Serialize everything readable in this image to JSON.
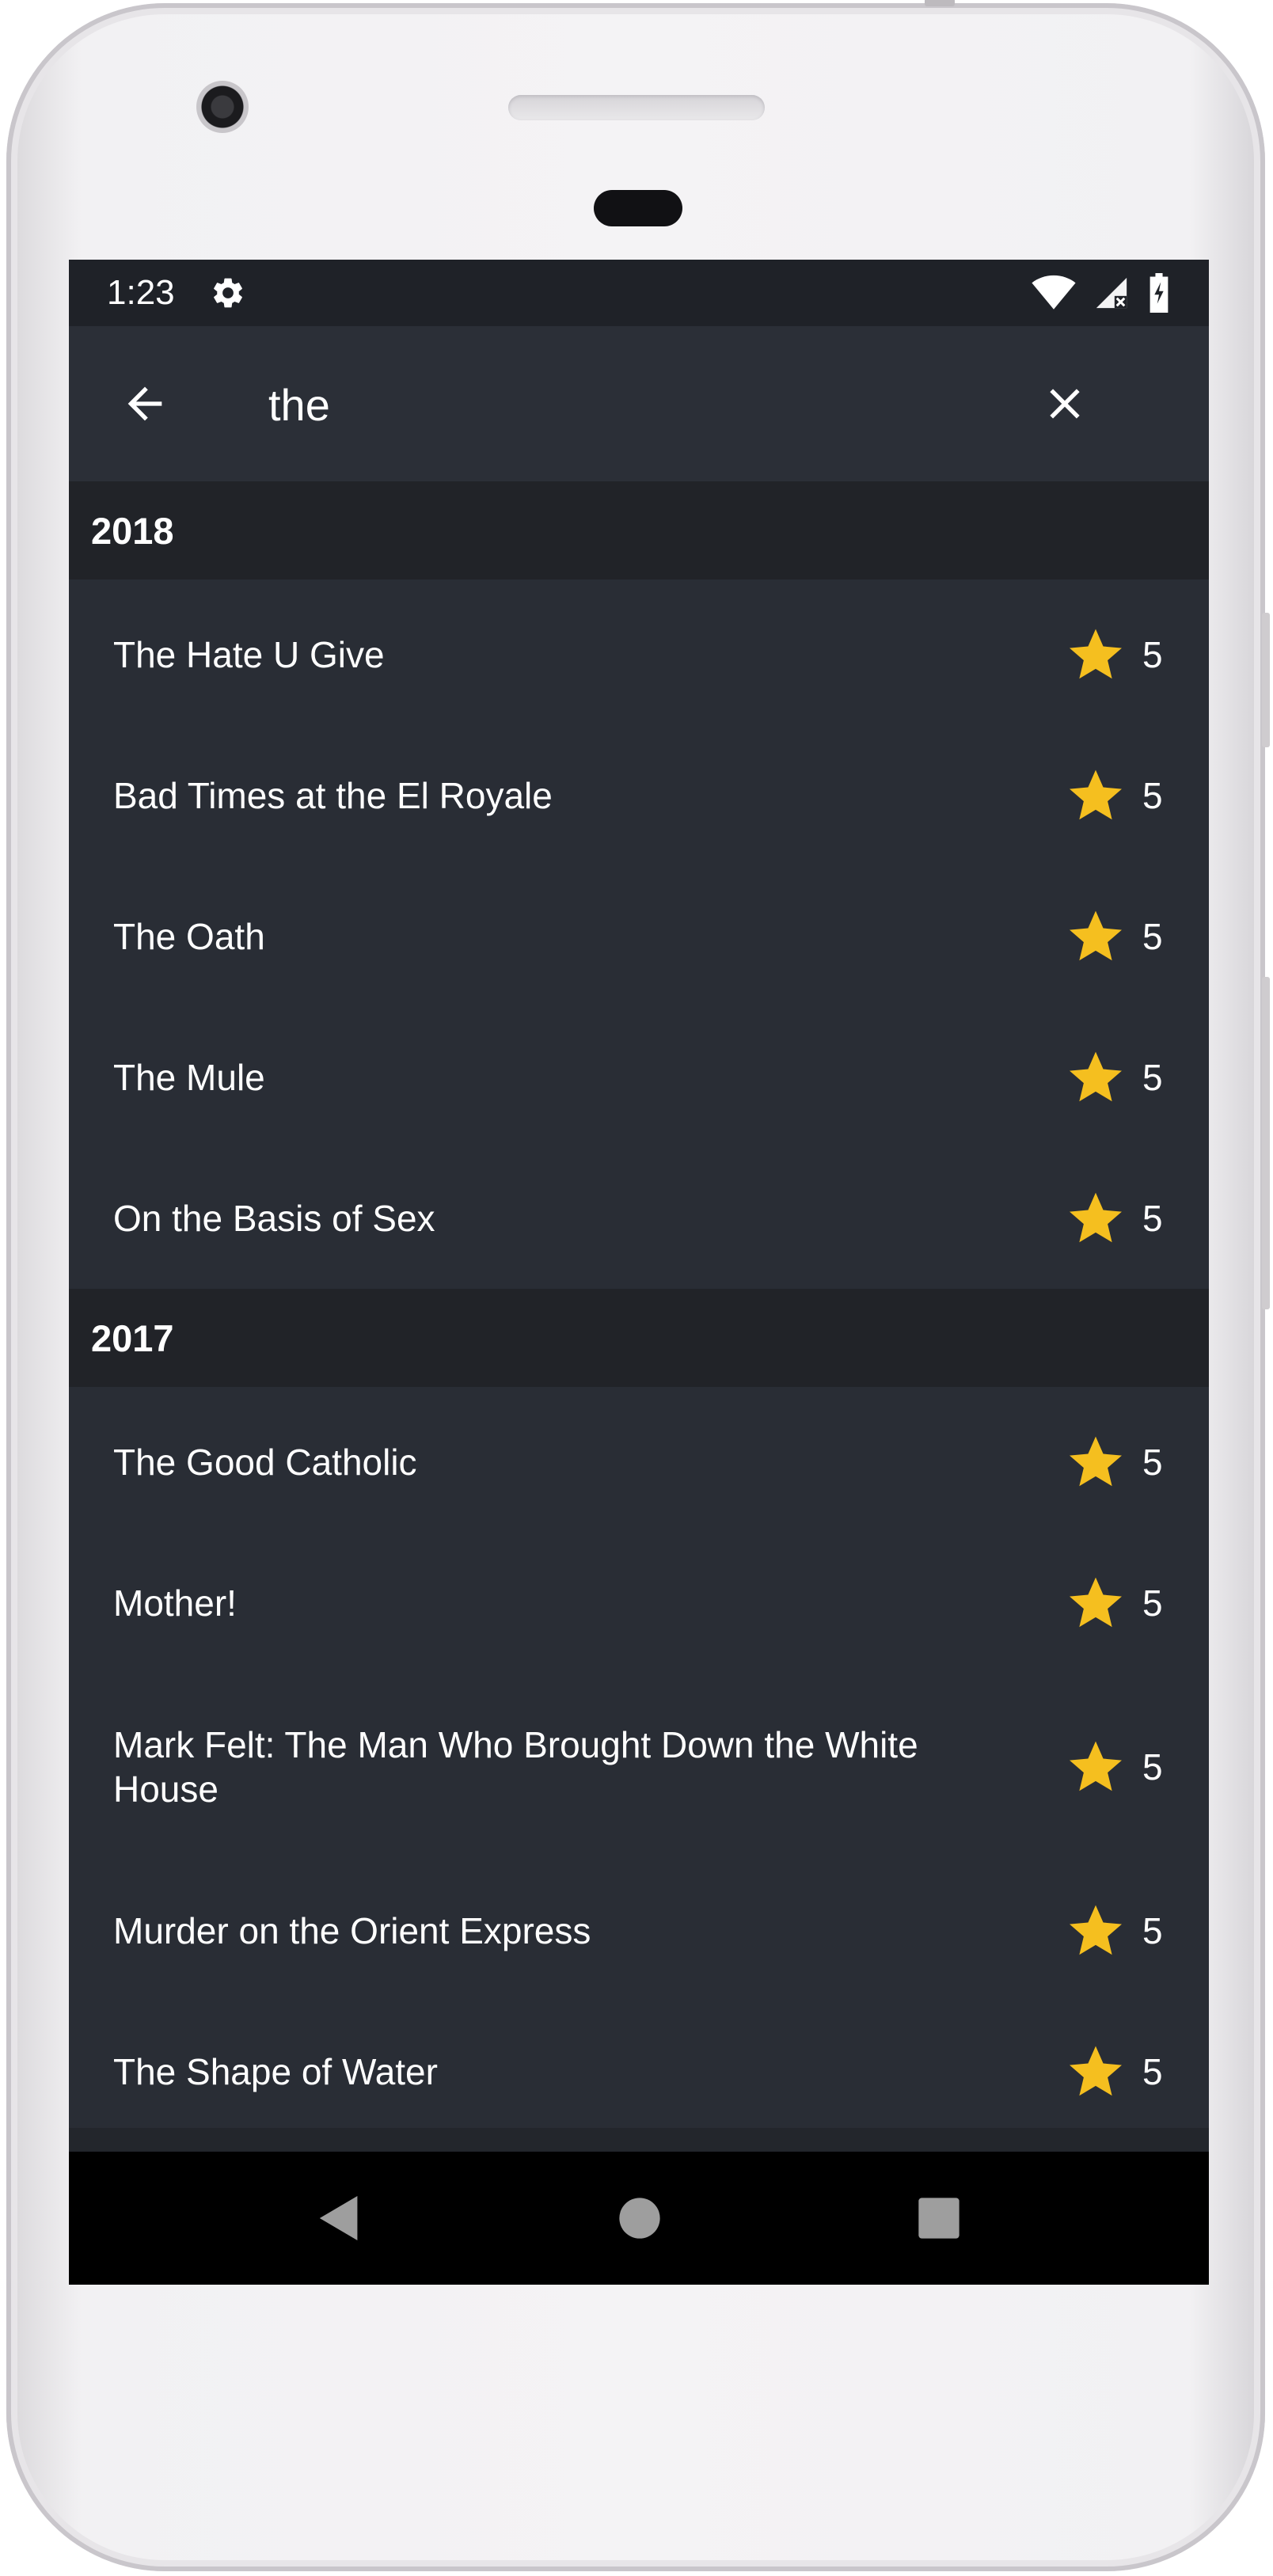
{
  "status_bar": {
    "time": "1:23",
    "icons": [
      "settings-gear-icon",
      "wifi-icon",
      "cell-signal-icon",
      "battery-icon"
    ]
  },
  "search": {
    "query": "the",
    "back_icon": "arrow-back-icon",
    "clear_icon": "close-icon"
  },
  "sections": [
    {
      "year": "2018",
      "movies": [
        {
          "title": "The Hate U Give",
          "rating": "5"
        },
        {
          "title": "Bad Times at the El Royale",
          "rating": "5"
        },
        {
          "title": "The Oath",
          "rating": "5"
        },
        {
          "title": "The Mule",
          "rating": "5"
        },
        {
          "title": "On the Basis of Sex",
          "rating": "5"
        }
      ]
    },
    {
      "year": "2017",
      "movies": [
        {
          "title": "The Good Catholic",
          "rating": "5"
        },
        {
          "title": "Mother!",
          "rating": "5"
        },
        {
          "title": "Mark Felt: The Man Who Brought Down the White House",
          "rating": "5"
        },
        {
          "title": "Murder on the Orient Express",
          "rating": "5"
        },
        {
          "title": "The Shape of Water",
          "rating": "5"
        }
      ]
    }
  ],
  "nav_bar": {
    "icons": [
      "back-triangle-icon",
      "home-circle-icon",
      "recents-square-icon"
    ]
  },
  "colors": {
    "star": "#f5bf1f",
    "screen_bg": "#292d35",
    "header_bg": "#212328",
    "status_bg": "#1f2228"
  }
}
